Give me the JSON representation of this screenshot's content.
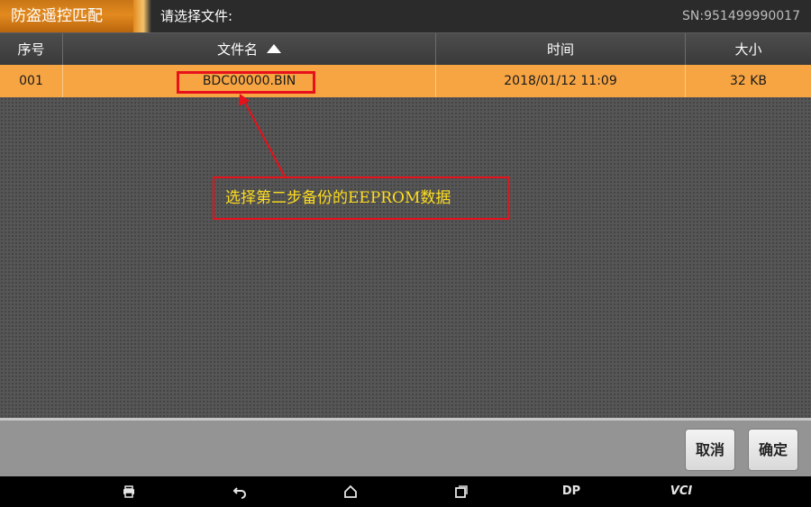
{
  "header": {
    "app_title": "防盗遥控匹配",
    "prompt": "请选择文件:",
    "serial": "SN:951499990017"
  },
  "table": {
    "columns": [
      "序号",
      "文件名",
      "时间",
      "大小"
    ],
    "sort_column": "文件名",
    "sort_direction": "ascending",
    "rows": [
      {
        "index": "001",
        "filename": "BDC00000.BIN",
        "time": "2018/01/12 11:09",
        "size": "32 KB",
        "selected": true
      }
    ]
  },
  "annotation": {
    "callout_text": "选择第二步备份的EEPROM数据",
    "color": "#e8101a",
    "text_color": "#ffdd1f"
  },
  "actions": {
    "cancel_label": "取消",
    "confirm_label": "确定"
  },
  "navbar": {
    "items": [
      {
        "icon": "print-icon"
      },
      {
        "icon": "back-icon"
      },
      {
        "icon": "home-icon"
      },
      {
        "icon": "recent-apps-icon"
      },
      {
        "label": "DP"
      },
      {
        "label": "VCI"
      }
    ]
  },
  "colors": {
    "accent": "#e38a1f",
    "selected_row": "#f7a543",
    "header_bg": "#2b2b2b"
  }
}
